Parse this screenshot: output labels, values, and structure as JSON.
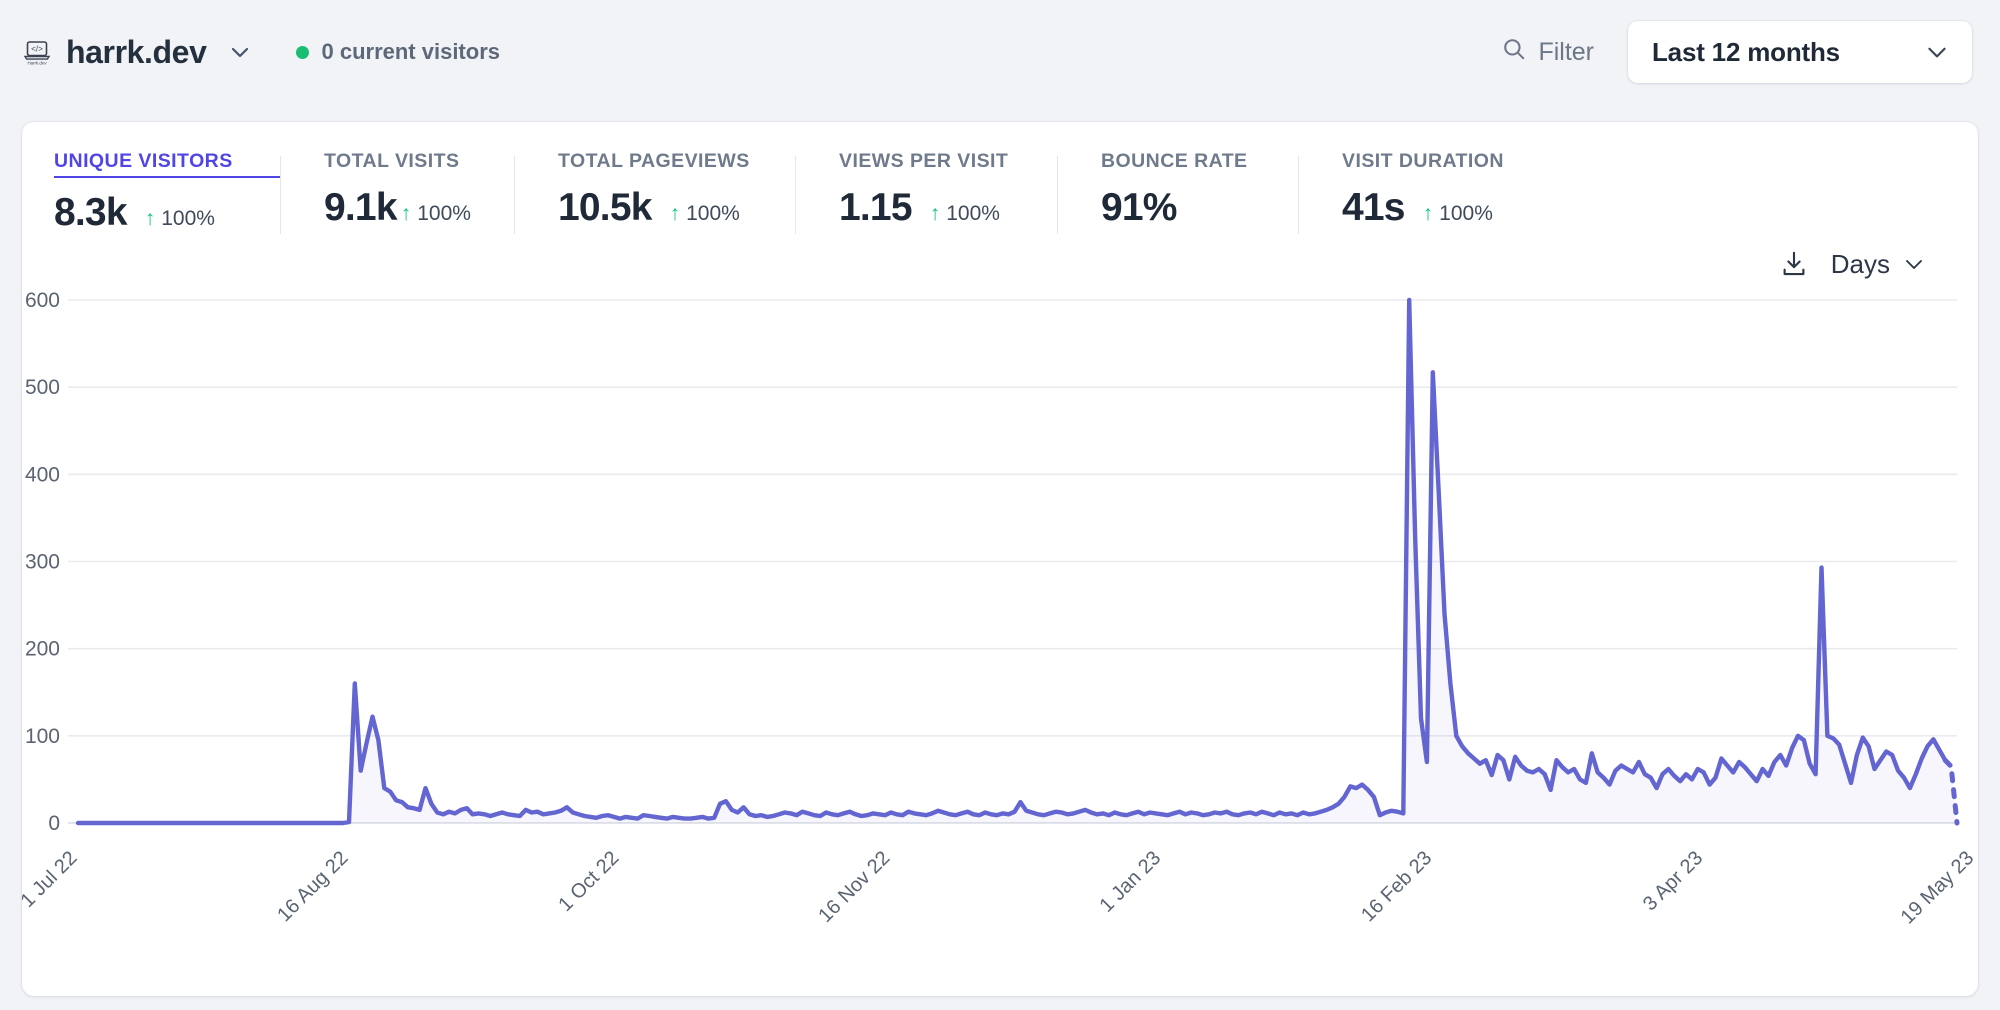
{
  "header": {
    "favicon_icon": "laptop-code-favicon",
    "favicon_caption": "Harrk.dev",
    "site_name": "harrk.dev",
    "site_caret_icon": "chevron-down-icon",
    "live_dot_color": "#1bbd73",
    "current_visitors": "0 current visitors",
    "filter_icon": "search-icon",
    "filter_label": "Filter",
    "period_value": "Last 12 months",
    "period_caret_icon": "chevron-down-icon"
  },
  "metrics": [
    {
      "title": "UNIQUE VISITORS",
      "value": "8.3k",
      "change": "100%",
      "trend": "up",
      "active": true
    },
    {
      "title": "TOTAL VISITS",
      "value": "9.1k",
      "change": "100%",
      "trend": "up",
      "active": false
    },
    {
      "title": "TOTAL PAGEVIEWS",
      "value": "10.5k",
      "change": "100%",
      "trend": "up",
      "active": false
    },
    {
      "title": "VIEWS PER VISIT",
      "value": "1.15",
      "change": "100%",
      "trend": "up",
      "active": false
    },
    {
      "title": "BOUNCE RATE",
      "value": "91%",
      "change": "",
      "trend": "",
      "active": false
    },
    {
      "title": "VISIT DURATION",
      "value": "41s",
      "change": "100%",
      "trend": "up",
      "active": false
    }
  ],
  "chart_toolbar": {
    "download_icon": "download-icon",
    "interval_label": "Days",
    "interval_caret_icon": "chevron-down-icon"
  },
  "chart_data": {
    "type": "line",
    "title": "",
    "xlabel": "",
    "ylabel": "",
    "ylim": [
      0,
      600
    ],
    "grid": true,
    "legend": "none",
    "line_color": "#6366d1",
    "fill_color": "rgba(99,102,209,0.06)",
    "y_ticks": [
      0,
      100,
      200,
      300,
      400,
      500,
      600
    ],
    "x_tick_labels": [
      "1 Jul 22",
      "16 Aug 22",
      "1 Oct 22",
      "16 Nov 22",
      "1 Jan 23",
      "16 Feb 23",
      "3 Apr 23",
      "19 May 23"
    ],
    "x_tick_indices": [
      0,
      46,
      92,
      138,
      184,
      230,
      276,
      322
    ],
    "x_label_rotation_deg": -45,
    "series": [
      {
        "name": "Unique visitors",
        "dashed_tail_points": 2,
        "values": [
          0,
          0,
          0,
          0,
          0,
          0,
          0,
          0,
          0,
          0,
          0,
          0,
          0,
          0,
          0,
          0,
          0,
          0,
          0,
          0,
          0,
          0,
          0,
          0,
          0,
          0,
          0,
          0,
          0,
          0,
          0,
          0,
          0,
          0,
          0,
          0,
          0,
          0,
          0,
          0,
          0,
          0,
          0,
          0,
          0,
          0,
          1,
          160,
          60,
          92,
          122,
          95,
          40,
          36,
          26,
          24,
          18,
          17,
          15,
          40,
          22,
          12,
          10,
          13,
          11,
          15,
          17,
          10,
          11,
          10,
          8,
          10,
          12,
          10,
          9,
          8,
          15,
          12,
          13,
          10,
          11,
          12,
          14,
          18,
          12,
          10,
          8,
          7,
          6,
          8,
          9,
          7,
          5,
          7,
          6,
          5,
          9,
          8,
          7,
          6,
          5,
          7,
          6,
          5,
          5,
          6,
          7,
          5,
          6,
          22,
          25,
          15,
          12,
          18,
          10,
          8,
          9,
          7,
          8,
          10,
          12,
          11,
          9,
          13,
          11,
          9,
          8,
          12,
          10,
          9,
          11,
          13,
          10,
          8,
          9,
          11,
          10,
          9,
          12,
          10,
          9,
          13,
          11,
          10,
          9,
          11,
          14,
          12,
          10,
          9,
          11,
          13,
          10,
          9,
          12,
          10,
          9,
          11,
          10,
          13,
          24,
          14,
          12,
          10,
          9,
          11,
          13,
          12,
          10,
          11,
          13,
          15,
          12,
          10,
          11,
          9,
          12,
          10,
          9,
          11,
          13,
          10,
          12,
          11,
          10,
          9,
          11,
          13,
          10,
          12,
          11,
          9,
          10,
          12,
          11,
          13,
          10,
          9,
          11,
          12,
          10,
          13,
          11,
          9,
          12,
          10,
          11,
          9,
          12,
          10,
          11,
          13,
          15,
          18,
          22,
          30,
          42,
          40,
          44,
          38,
          30,
          9,
          12,
          14,
          13,
          11,
          600,
          330,
          120,
          70,
          517,
          380,
          240,
          160,
          100,
          88,
          80,
          74,
          68,
          72,
          55,
          78,
          72,
          50,
          76,
          66,
          60,
          58,
          62,
          56,
          38,
          72,
          64,
          58,
          62,
          50,
          46,
          80,
          58,
          52,
          44,
          60,
          66,
          62,
          58,
          70,
          56,
          52,
          40,
          56,
          62,
          54,
          48,
          56,
          50,
          62,
          58,
          44,
          52,
          74,
          66,
          58,
          70,
          64,
          56,
          48,
          62,
          54,
          70,
          78,
          66,
          86,
          100,
          95,
          68,
          56,
          293,
          100,
          97,
          90,
          68,
          46,
          78,
          98,
          88,
          62,
          72,
          82,
          78,
          60,
          52,
          40,
          56,
          74,
          88,
          96,
          84,
          72,
          65,
          0
        ]
      }
    ]
  }
}
